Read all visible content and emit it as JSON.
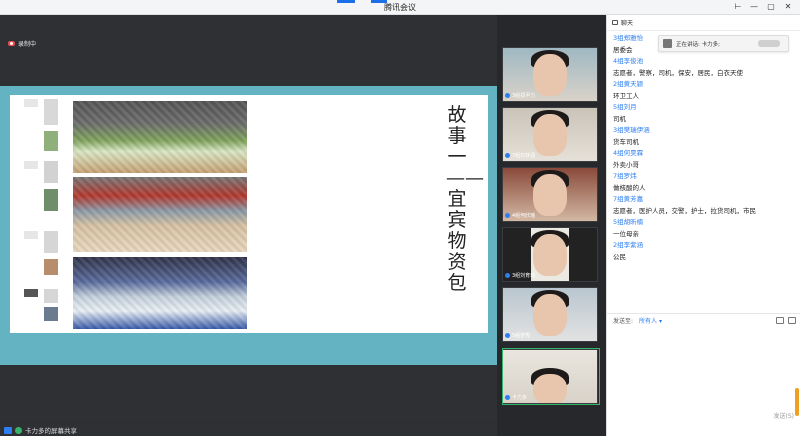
{
  "window": {
    "title": "腾讯会议",
    "controls": {
      "pin": "⊢",
      "minimize": "—",
      "maximize": "▢",
      "close": "✕"
    }
  },
  "main": {
    "recording_label": "录制中",
    "slide": {
      "title": "故事一——宜宾物资包"
    },
    "footer_share_label": "卡力多的屏幕共享"
  },
  "videos": {
    "tiles": [
      {
        "name": "3组郑尹力"
      },
      {
        "name": "7组石林涵"
      },
      {
        "name": "4组何欣瑶"
      },
      {
        "name": "3组刘育琼"
      },
      {
        "name": "5组罗秀"
      },
      {
        "name": "卡力多"
      }
    ]
  },
  "chat": {
    "title": "聊天",
    "speaking_label": "正在讲话: 卡力多;",
    "messages": [
      {
        "sender": "3组郑雅怡",
        "text": "居委会"
      },
      {
        "sender": "4组李俊池",
        "text": "志愿者，警察，司机，保安，居民，白衣天使"
      },
      {
        "sender": "2组黄天颖",
        "text": "环卫工人"
      },
      {
        "sender": "5组刘月",
        "text": "司机"
      },
      {
        "sender": "3组樊瑞伊涵",
        "text": "货车司机"
      },
      {
        "sender": "4组何昊霖",
        "text": "外卖小哥"
      },
      {
        "sender": "7组罗炜",
        "text": "做核酸的人"
      },
      {
        "sender": "7组黄芳嘉",
        "text": "志愿者，医护人员，交警，护士，拉货司机，市民"
      },
      {
        "sender": "5组胡昕楠",
        "text": "一位母亲"
      },
      {
        "sender": "2组李紫涵",
        "text": "公民"
      }
    ],
    "send_to_label": "发送至:",
    "send_to_value": "所有人 ▾",
    "send_button": "发送(S)"
  },
  "colors": {
    "accent": "#2d7ff0",
    "share_background": "#63b3c3",
    "active_speaker_border": "#31b56a",
    "recording": "#e84b4b"
  }
}
